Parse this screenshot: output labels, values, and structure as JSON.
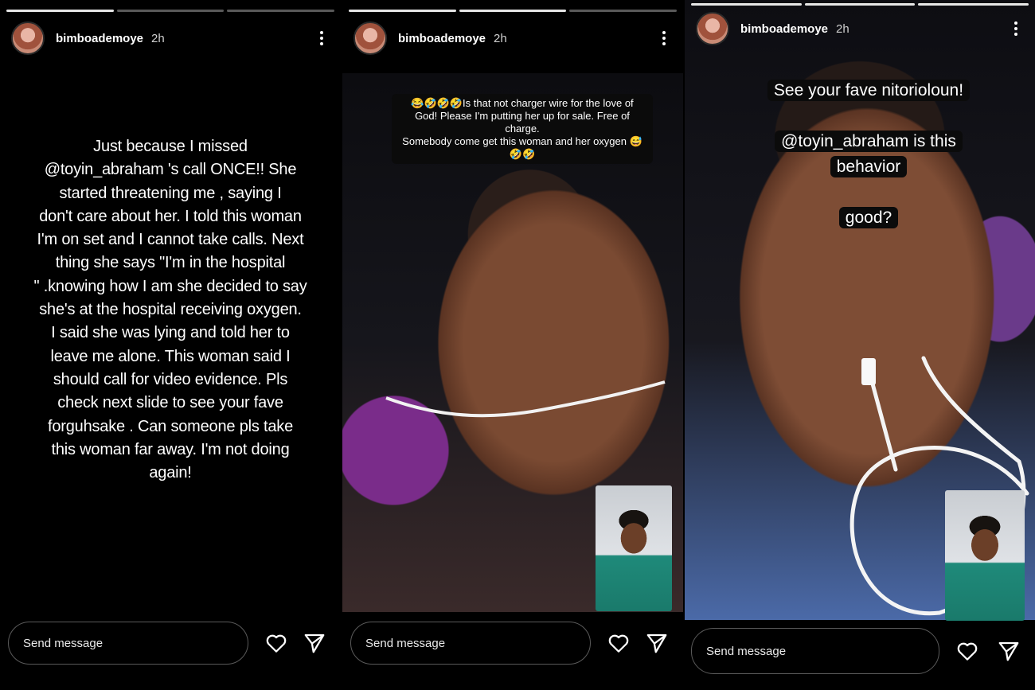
{
  "colors": {
    "background": "#000000",
    "text": "#ffffff",
    "input_border": "#5a5a5a"
  },
  "stories": [
    {
      "username": "bimboademoye",
      "time": "2h",
      "text": "Just because I missed\n@toyin_abraham 's call ONCE!! She\nstarted threatening me , saying I\ndon't care about her. I told this woman\nI'm on set and I cannot take calls. Next\nthing she says \"I'm in the hospital\n\" .knowing how I am she decided to say\nshe's at the hospital receiving oxygen.\nI said she was lying and told her to\nleave me alone. This woman said I\nshould call for video evidence. Pls\ncheck next slide to see your fave\nforguhsake . Can someone pls take\nthis woman far away. I'm not doing\nagain!",
      "message_placeholder": "Send message",
      "icons": [
        "more-icon",
        "heart-icon",
        "send-icon"
      ]
    },
    {
      "username": "bimboademoye",
      "time": "2h",
      "caption": "😂🤣🤣🤣Is that not charger wire for the love of\nGod! Please I'm putting her up for sale. Free of charge.\nSomebody come get this woman and her oxygen 😅\n🤣🤣",
      "message_placeholder": "Send message",
      "icons": [
        "more-icon",
        "heart-icon",
        "send-icon"
      ]
    },
    {
      "username": "bimboademoye",
      "time": "2h",
      "caption_lines": [
        "See your fave nitorioloun!",
        "@toyin_abraham is this behavior",
        "good?"
      ],
      "message_placeholder": "Send message",
      "icons": [
        "more-icon",
        "heart-icon",
        "send-icon"
      ]
    }
  ]
}
